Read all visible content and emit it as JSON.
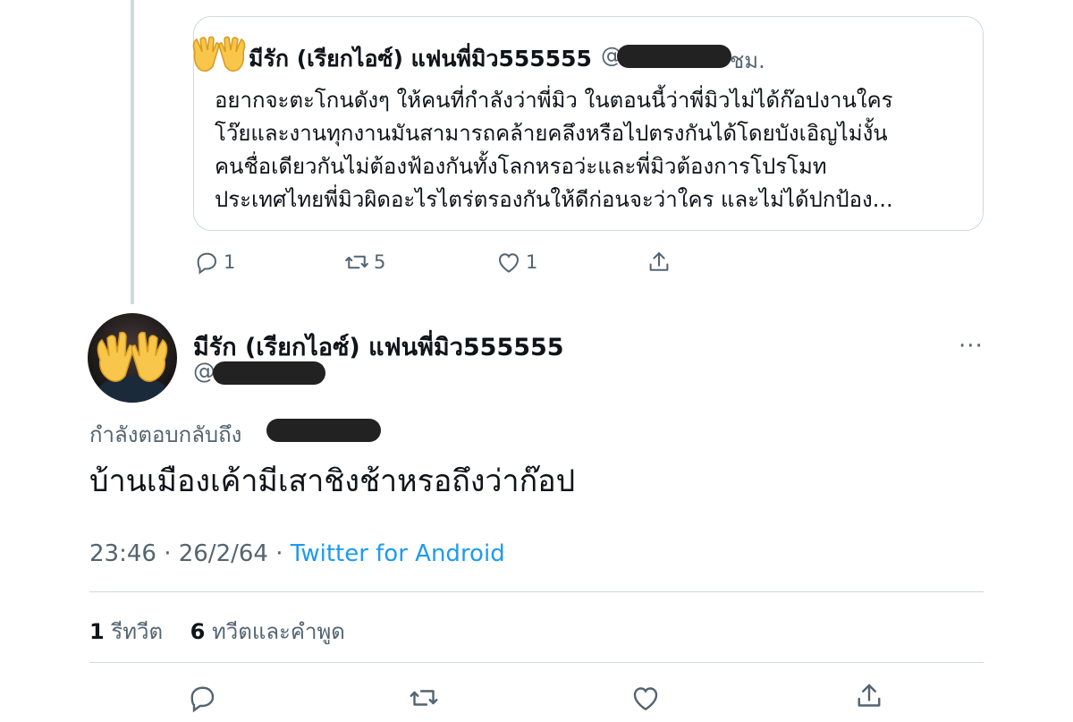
{
  "quoted_tweet": {
    "display_name": "มีรัก (เรียกไอซ์) แฟนพี่มิว555555",
    "handle_prefix": "@",
    "time": "ชม.",
    "text_lines": [
      "อยากจะตะโกนดังๆ ให้คนที่กำลังว่าพี่มิว ในตอนนี้ว่าพี่มิวไม่ได้ก๊อปงานใคร",
      "โว๊ยและงานทุกงานมันสามารถคล้ายคลึงหรือไปตรงกันได้โดยบังเอิญไม่งั้น",
      "คนชื่อเดียวกันไม่ต้องฟ้องกันทั้งโลกหรอว่ะและพี่มิวต้องการโปรโมท",
      "ประเทศไทยพี่มิวผิดอะไรไตร่ตรองกันให้ดีก่อนจะว่าใคร และไม่ได้ปกป้อง..."
    ],
    "actions": {
      "reply_count": "1",
      "retweet_count": "5",
      "like_count": "1"
    }
  },
  "main_tweet": {
    "display_name": "มีรัก (เรียกไอซ์) แฟนพี่มิว555555",
    "handle_prefix": "@",
    "more": "···",
    "reply_to_label": "กำลังตอบกลับถึง",
    "text": "บ้านเมืองเค้ามีเสาชิงช้าหรอถึงว่าก๊อป",
    "timestamp": "23:46 · 26/2/64 · ",
    "source": "Twitter for Android",
    "retweets": {
      "count": "1",
      "label": "รีทวีต"
    },
    "quotes": {
      "count": "6",
      "label": "ทวีตและคำพูด"
    }
  },
  "colors": {
    "accent": "#1d9bf0",
    "secondary_text": "#536471",
    "border": "#cfd9de"
  },
  "icons": [
    "reply-icon",
    "retweet-icon",
    "like-icon",
    "share-icon",
    "more-icon",
    "raised-hands-emoji"
  ]
}
